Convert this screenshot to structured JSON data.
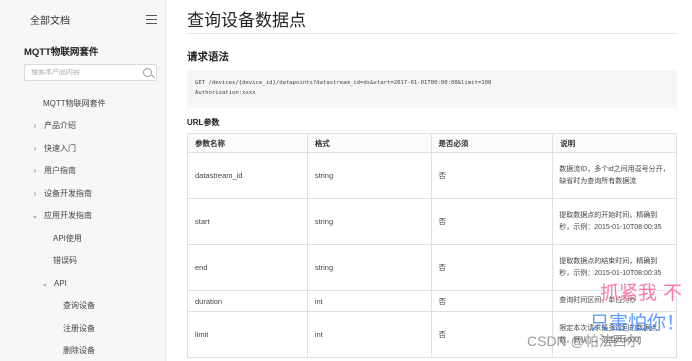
{
  "sidebar": {
    "all_docs": "全部文档",
    "product_title": "MQTT物联网套件",
    "search_placeholder": "搜索本产品内容",
    "items": [
      {
        "label": "MQTT物联网套件",
        "level": 0,
        "chevron": ""
      },
      {
        "label": "产品介绍",
        "level": 1,
        "chevron": "›"
      },
      {
        "label": "快速入门",
        "level": 1,
        "chevron": "›"
      },
      {
        "label": "用户指南",
        "level": 1,
        "chevron": "›"
      },
      {
        "label": "设备开发指南",
        "level": 1,
        "chevron": "›"
      },
      {
        "label": "应用开发指南",
        "level": 1,
        "chevron": "⌄"
      },
      {
        "label": "API使用",
        "level": 2,
        "chevron": ""
      },
      {
        "label": "错误码",
        "level": 2,
        "chevron": ""
      },
      {
        "label": "API",
        "level": 2,
        "chevron": "⌄"
      },
      {
        "label": "查询设备",
        "level": 3,
        "chevron": ""
      },
      {
        "label": "注册设备",
        "level": 3,
        "chevron": ""
      },
      {
        "label": "删除设备",
        "level": 3,
        "chevron": ""
      }
    ]
  },
  "main": {
    "title": "查询设备数据点",
    "request_section": "请求语法",
    "code_line1": "GET /devices/{device_id}/datapoints?datastream_id=ds&start=2017-01-01T00:00:00&limit=100",
    "code_line2": "Authorization:xxxx",
    "url_params_title": "URL参数",
    "table": {
      "headers": [
        "参数名称",
        "格式",
        "是否必须",
        "说明"
      ],
      "rows": [
        {
          "name": "datastream_id",
          "format": "string",
          "required": "否",
          "desc": "数据流ID，多个id之间用逗号分开，缺省时为查询所有数据流"
        },
        {
          "name": "start",
          "format": "string",
          "required": "否",
          "desc": "提取数据点的开始时间，精确到秒，示例：2015-01-10T08:00:35"
        },
        {
          "name": "end",
          "format": "string",
          "required": "否",
          "desc": "提取数据点的结束时间，精确到秒，示例：2015-01-10T08:00:35"
        },
        {
          "name": "duration",
          "format": "int",
          "required": "否",
          "desc": "查询时间区间，单位为秒"
        },
        {
          "name": "limit",
          "format": "int",
          "required": "否",
          "desc": "限定本次请求最多返回的数据点数，默认…，范围(0,6000]"
        }
      ]
    }
  },
  "watermark": {
    "red_text": "抓紧我 不",
    "blue_text": "只害怕你！",
    "csdn_text": "CSDN @帕法西尔"
  }
}
